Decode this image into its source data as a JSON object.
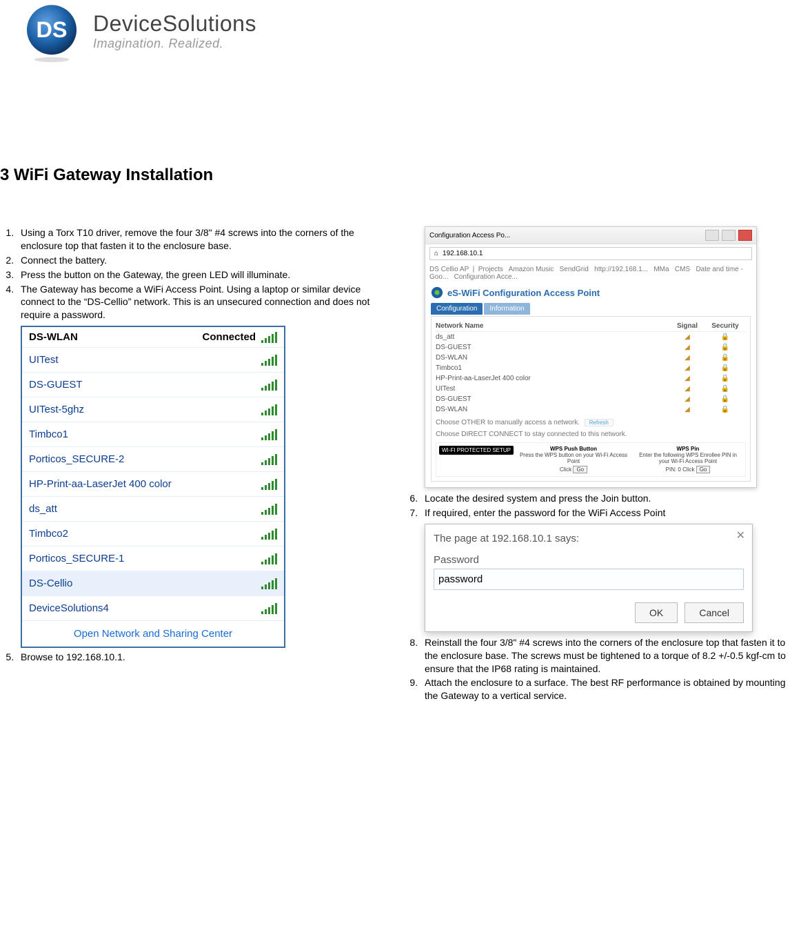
{
  "logo": {
    "brand": "DeviceSolutions",
    "tagline": "Imagination. Realized.",
    "mark_text": "DS"
  },
  "heading": "3 WiFi Gateway Installation",
  "left_steps": [
    "Using a Torx T10 driver, remove the four 3/8\" #4 screws into the corners of the enclosure top that fasten it to the enclosure base.",
    "Connect the battery.",
    "Press the button on the Gateway, the green LED will illuminate.",
    "The Gateway has become a WiFi Access Point. Using a laptop or similar device connect to the “DS-Cellio” network. This is an unsecured connection and does not require a password."
  ],
  "wifi_panel": {
    "head_name": "DS-WLAN",
    "head_status": "Connected",
    "items": [
      "UITest",
      "DS-GUEST",
      "UITest-5ghz",
      "Timbco1",
      "Porticos_SECURE-2",
      "HP-Print-aa-LaserJet 400 color",
      "ds_att",
      "Timbco2",
      "Porticos_SECURE-1",
      "DS-Cellio",
      "DeviceSolutions4"
    ],
    "selected": "DS-Cellio",
    "footer": "Open Network and Sharing Center"
  },
  "step5": "Browse to  192.168.10.1.",
  "cfg_shot": {
    "win_title": "Configuration Access Po...",
    "url": "192.168.10.1",
    "tabs_line": "DS Cellio AP  |  Projects   Amazon Music   SendGrid   http://192.168.1...   MMa   CMS   Date and time - Goo...   Configuration Acce...",
    "brand": "eS-WiFi Configuration Access Point",
    "nav": [
      "Configuration",
      "Information"
    ],
    "thead": [
      "Network Name",
      "Signal",
      "Security"
    ],
    "rows": [
      "ds_att",
      "DS-GUEST",
      "DS-WLAN",
      "Timbco1",
      "HP-Print-aa-LaserJet 400 color",
      "UITest",
      "DS-GUEST",
      "DS-WLAN"
    ],
    "note1": "Choose OTHER to manually access a network.",
    "refresh": "Refresh",
    "note2": "Choose DIRECT CONNECT to stay connected to this network.",
    "wps_setup": "WI-FI PROTECTED SETUP",
    "wps_push": {
      "title": "WPS Push Button",
      "desc": "Press the WPS button on your Wi-Fi Access Point",
      "action_prefix": "Click",
      "button": "Go"
    },
    "wps_pin": {
      "title": "WPS Pin",
      "desc": "Enter the following WPS Enrollee PIN in your Wi-Fi Access Point",
      "pin": "PIN: 0",
      "action_prefix": "Click",
      "button": "Go"
    }
  },
  "right_steps_a": [
    "Locate the desired system and press the Join button.",
    "If required, enter the password for the WiFi Access Point"
  ],
  "dlg": {
    "title": "The page at 192.168.10.1 says:",
    "label": "Password",
    "value": "password",
    "ok": "OK",
    "cancel": "Cancel"
  },
  "right_steps_b": [
    "Reinstall the four 3/8\" #4 screws into the corners of the enclosure top that fasten it to the enclosure base. The screws must be tightened to a torque of 8.2 +/-0.5 kgf-cm to ensure that the IP68 rating is maintained.",
    "Attach the enclosure to a surface. The best RF performance is obtained by mounting the Gateway to a vertical service."
  ]
}
